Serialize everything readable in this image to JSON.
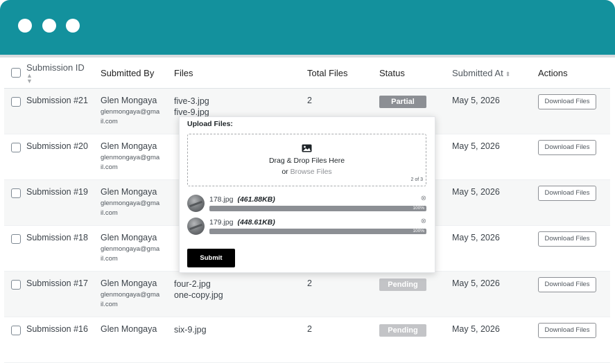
{
  "columns": {
    "submission_id": "Submission ID",
    "submitted_by": "Submitted By",
    "files": "Files",
    "total_files": "Total Files",
    "status": "Status",
    "submitted_at": "Submitted At",
    "actions": "Actions"
  },
  "rows": [
    {
      "id": "Submission #21",
      "name": "Glen Mongaya",
      "email1": "glenmongaya@gma",
      "email2": "il.com",
      "files": [
        "five-3.jpg",
        "five-9.jpg"
      ],
      "total": "2",
      "status": "Partial",
      "date": "May 5, 2026",
      "action": "Download Files"
    },
    {
      "id": "Submission #20",
      "name": "Glen Mongaya",
      "email1": "glenmongaya@gma",
      "email2": "il.com",
      "files": [
        "",
        ""
      ],
      "total": "",
      "status": "",
      "date": "May 5, 2026",
      "action": "Download Files"
    },
    {
      "id": "Submission #19",
      "name": "Glen Mongaya",
      "email1": "glenmongaya@gma",
      "email2": "il.com",
      "files": [
        "",
        ""
      ],
      "total": "",
      "status": "",
      "date": "May 5, 2026",
      "action": "Download Files"
    },
    {
      "id": "Submission #18",
      "name": "Glen Mongaya",
      "email1": "glenmongaya@gma",
      "email2": "il.com",
      "files": [
        "",
        ""
      ],
      "total": "",
      "status": "",
      "date": "May 5, 2026",
      "action": "Download Files"
    },
    {
      "id": "Submission #17",
      "name": "Glen Mongaya",
      "email1": "glenmongaya@gma",
      "email2": "il.com",
      "files": [
        "four-2.jpg",
        "one-copy.jpg"
      ],
      "total": "2",
      "status": "Pending",
      "date": "May 5, 2026",
      "action": "Download Files"
    },
    {
      "id": "Submission #16",
      "name": "Glen Mongaya",
      "email1": "",
      "email2": "",
      "files": [
        "six-9.jpg",
        ""
      ],
      "total": "2",
      "status": "Pending",
      "date": "May 5, 2026",
      "action": "Download Files"
    }
  ],
  "upload": {
    "title": "Upload Files:",
    "drop_text": "Drag & Drop Files Here",
    "or_text": "or",
    "browse_text": "Browse Files",
    "count": "2 of 3",
    "items": [
      {
        "name": "178.jpg",
        "size": "(461.88KB)",
        "progress_label": "100%",
        "progress": 1.0
      },
      {
        "name": "179.jpg",
        "size": "(448.61KB)",
        "progress_label": "100%",
        "progress": 1.0
      }
    ],
    "submit_label": "Submit"
  },
  "icons": {
    "sort": "sort-icon",
    "image": "image-icon",
    "remove": "remove-circle-icon",
    "window_dots": "window-dots"
  },
  "colors": {
    "header_bar": "#13919d",
    "badge_partial": "#8c8f94",
    "badge_pending": "#c3c4c7",
    "submit": "#000000"
  }
}
